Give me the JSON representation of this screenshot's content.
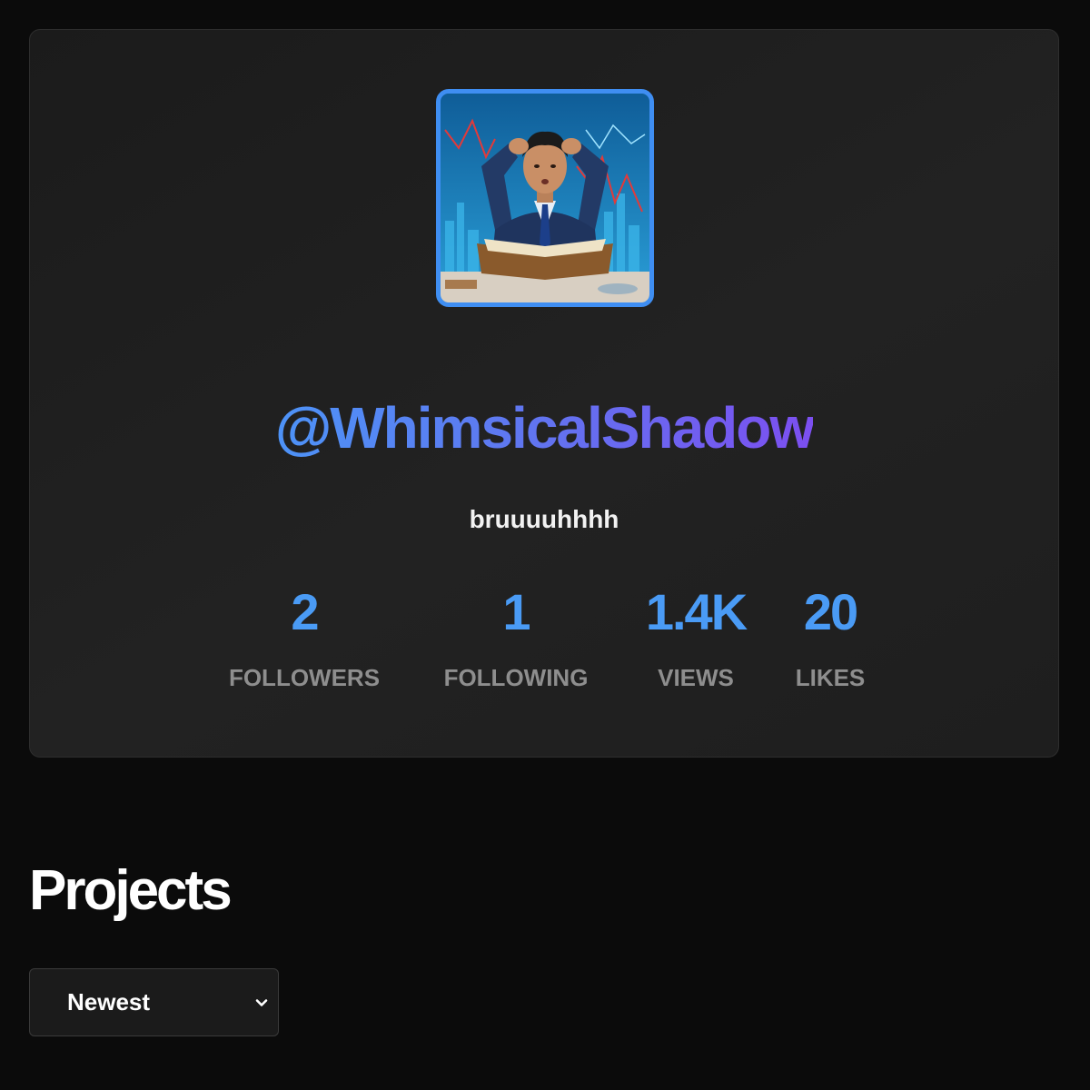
{
  "profile": {
    "username": "@WhimsicalShadow",
    "bio": "bruuuuhhhh",
    "avatar_description_icon": "profile-photo",
    "accent_color": "#4a9bf5",
    "stats": [
      {
        "value": "2",
        "label": "FOLLOWERS"
      },
      {
        "value": "1",
        "label": "FOLLOWING"
      },
      {
        "value": "1.4K",
        "label": "VIEWS"
      },
      {
        "value": "20",
        "label": "LIKES"
      }
    ]
  },
  "projects": {
    "title": "Projects",
    "sort": {
      "selected": "Newest",
      "icon": "chevron-down-icon"
    }
  }
}
